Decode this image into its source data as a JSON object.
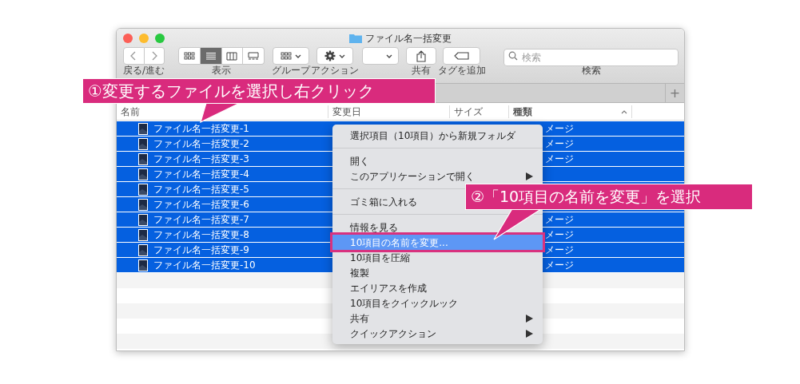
{
  "window": {
    "title": "ファイル名一括変更"
  },
  "toolbar": {
    "items": [
      {
        "kind": "nav",
        "label": "戻る/進む"
      },
      {
        "kind": "view",
        "label": "表示",
        "modes": [
          {
            "selected": false
          },
          {
            "selected": true
          },
          {
            "selected": false
          },
          {
            "selected": false
          }
        ]
      },
      {
        "kind": "group",
        "label": "グループ"
      },
      {
        "kind": "action",
        "label": "アクション"
      },
      {
        "kind": "dropdown"
      },
      {
        "kind": "share",
        "label": "共有"
      },
      {
        "kind": "tag",
        "label": "タグを追加"
      },
      {
        "kind": "search",
        "label": "検索",
        "placeholder": "検索"
      }
    ]
  },
  "tab_bar": {
    "add_button": "+"
  },
  "columns": [
    {
      "label": "名前",
      "sorted": false
    },
    {
      "label": "変更日",
      "sorted": false
    },
    {
      "label": "サイズ",
      "sorted": false
    },
    {
      "label": "種類",
      "sorted": true
    }
  ],
  "rows": [
    {
      "name": "ファイル名一括変更-1",
      "kind_text": "メージ",
      "selected": true
    },
    {
      "name": "ファイル名一括変更-2",
      "kind_text": "メージ",
      "selected": true
    },
    {
      "name": "ファイル名一括変更-3",
      "kind_text": "メージ",
      "selected": true
    },
    {
      "name": "ファイル名一括変更-4",
      "selected": true
    },
    {
      "name": "ファイル名一括変更-5",
      "selected": true
    },
    {
      "name": "ファイル名一括変更-6",
      "selected": true
    },
    {
      "name": "ファイル名一括変更-7",
      "kind_text": "メージ",
      "selected": true
    },
    {
      "name": "ファイル名一括変更-8",
      "kind_text": "メージ",
      "selected": true
    },
    {
      "name": "ファイル名一括変更-9",
      "kind_text": "メージ",
      "selected": true
    },
    {
      "name": "ファイル名一括変更-10",
      "kind_text": "メージ",
      "selected": true
    }
  ],
  "context_menu": {
    "items": [
      {
        "kind": "item",
        "label": "選択項目（10項目）から新規フォルダ",
        "highlighted": false
      },
      {
        "kind": "separator"
      },
      {
        "kind": "item",
        "label": "開く",
        "highlighted": false
      },
      {
        "kind": "submenu",
        "label": "このアプリケーションで開く",
        "highlighted": false
      },
      {
        "kind": "separator"
      },
      {
        "kind": "item",
        "label": "ゴミ箱に入れる",
        "highlighted": false
      },
      {
        "kind": "separator"
      },
      {
        "kind": "item",
        "label": "情報を見る",
        "highlighted": false
      },
      {
        "kind": "item",
        "label": "10項目の名前を変更...",
        "highlighted": true
      },
      {
        "kind": "item",
        "label": "10項目を圧縮",
        "highlighted": false
      },
      {
        "kind": "item",
        "label": "複製",
        "highlighted": false
      },
      {
        "kind": "item",
        "label": "エイリアスを作成",
        "highlighted": false
      },
      {
        "kind": "item",
        "label": "10項目をクイックルック",
        "highlighted": false
      },
      {
        "kind": "submenu",
        "label": "共有",
        "highlighted": false
      },
      {
        "kind": "submenu",
        "label": "クイックアクション",
        "highlighted": false
      }
    ]
  },
  "callouts": [
    {
      "text": "①変更するファイルを選択し右クリック"
    },
    {
      "text": "②「10項目の名前を変更」を選択"
    }
  ]
}
